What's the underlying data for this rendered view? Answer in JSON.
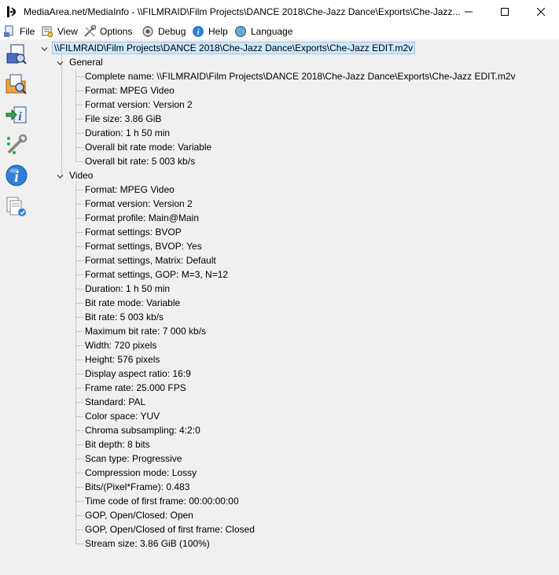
{
  "window": {
    "title": "MediaArea.net/MediaInfo - \\\\FILMRAID\\Film Projects\\DANCE 2018\\Che-Jazz Dance\\Exports\\Che-Jazz..."
  },
  "menu": {
    "file": "File",
    "view": "View",
    "options": "Options",
    "debug": "Debug",
    "help": "Help",
    "language": "Language"
  },
  "sidebar": {
    "icons": [
      "open-file-icon",
      "open-folder-icon",
      "export-icon",
      "preferences-icon",
      "about-icon",
      "knowledge-base-icon"
    ]
  },
  "tree": {
    "root": "\\\\FILMRAID\\Film Projects\\DANCE 2018\\Che-Jazz Dance\\Exports\\Che-Jazz EDIT.m2v",
    "general": {
      "label": "General",
      "items": [
        "Complete name: \\\\FILMRAID\\Film Projects\\DANCE 2018\\Che-Jazz Dance\\Exports\\Che-Jazz EDIT.m2v",
        "Format: MPEG Video",
        "Format version: Version 2",
        "File size: 3.86 GiB",
        "Duration: 1 h 50 min",
        "Overall bit rate mode: Variable",
        "Overall bit rate: 5 003 kb/s"
      ]
    },
    "video": {
      "label": "Video",
      "items": [
        "Format: MPEG Video",
        "Format version: Version 2",
        "Format profile: Main@Main",
        "Format settings: BVOP",
        "Format settings, BVOP: Yes",
        "Format settings, Matrix: Default",
        "Format settings, GOP: M=3, N=12",
        "Duration: 1 h 50 min",
        "Bit rate mode: Variable",
        "Bit rate: 5 003 kb/s",
        "Maximum bit rate: 7 000 kb/s",
        "Width: 720 pixels",
        "Height: 576 pixels",
        "Display aspect ratio: 16:9",
        "Frame rate: 25.000 FPS",
        "Standard: PAL",
        "Color space: YUV",
        "Chroma subsampling: 4:2:0",
        "Bit depth: 8 bits",
        "Scan type: Progressive",
        "Compression mode: Lossy",
        "Bits/(Pixel*Frame): 0.483",
        "Time code of first frame: 00:00:00:00",
        "GOP, Open/Closed: Open",
        "GOP, Open/Closed of first frame: Closed",
        "Stream size: 3.86 GiB (100%)"
      ]
    }
  }
}
